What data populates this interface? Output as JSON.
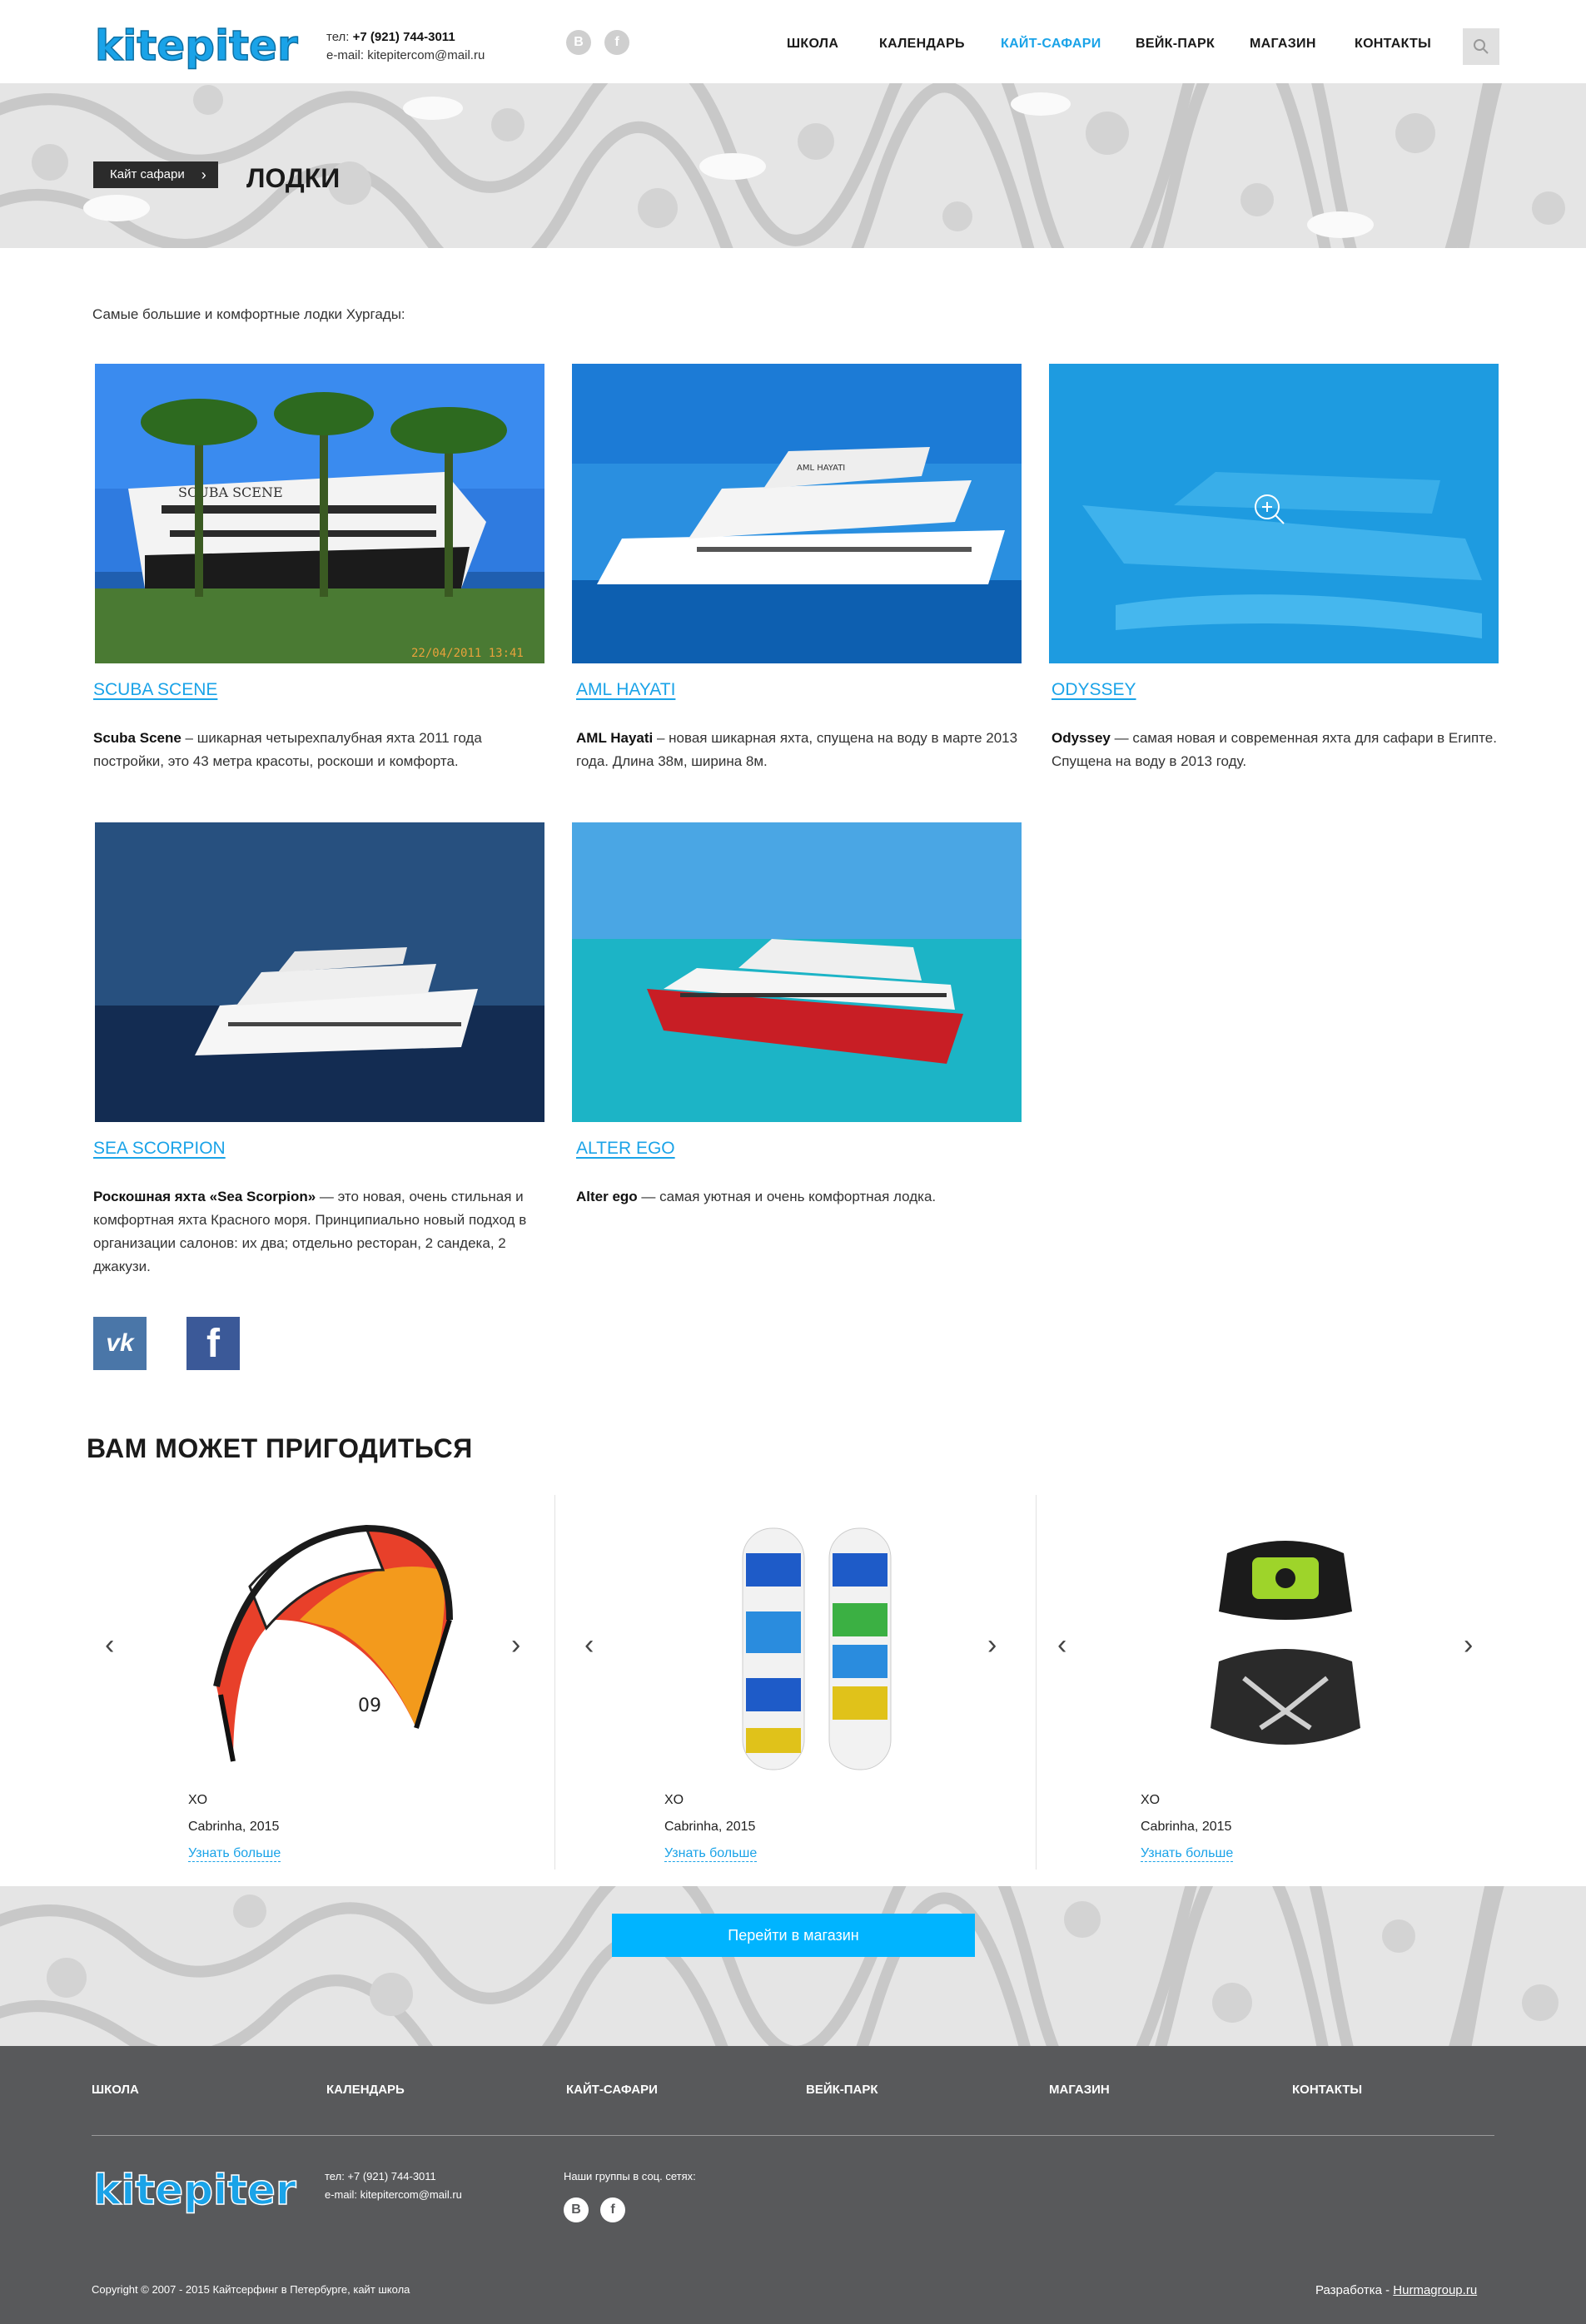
{
  "header": {
    "logo_text": "kitepiter",
    "phone_label": "тел:",
    "phone": "+7 (921) 744-3011",
    "email_label": "e-mail:",
    "email": "kitepitercom@mail.ru",
    "social": [
      "В",
      "f"
    ],
    "nav": [
      {
        "label": "ШКОЛА",
        "active": false
      },
      {
        "label": "КАЛЕНДАРЬ",
        "active": false
      },
      {
        "label": "КАЙТ-САФАРИ",
        "active": true
      },
      {
        "label": "ВЕЙК-ПАРК",
        "active": false
      },
      {
        "label": "МАГАЗИН",
        "active": false
      },
      {
        "label": "КОНТАКТЫ",
        "active": false
      }
    ]
  },
  "breadcrumb": "Кайт сафари",
  "page_title": "ЛОДКИ",
  "intro": "Самые большие и комфортные лодки Хургады:",
  "boats": [
    {
      "name": "SCUBA SCENE",
      "bold": "Scuba Scene",
      "text": " – шикарная четырехпалубная яхта 2011 года постройки, это 43 метра красоты, роскоши и комфорта.",
      "hull_text": "SCUBA SCENE",
      "photo_stamp": "22/04/2011 13:41"
    },
    {
      "name": "AML HAYATI",
      "bold": "AML Hayati",
      "text": " – новая шикарная яхта, спущена на воду в марте 2013 года. Длина 38м, ширина 8м.",
      "hull_text": "AML HAYATI"
    },
    {
      "name": "ODYSSEY",
      "bold": "Odyssey",
      "text": " — самая новая и современная яхта для сафари в Египте. Спущена на воду в 2013 году."
    },
    {
      "name": "SEA SCORPION",
      "bold": "Роскошная яхта «Sea Scorpion»",
      "text": " — это новая, очень стильная и комфортная яхта Красного моря. Принципиально новый подход в организации салонов: их два; отдельно ресторан, 2 сандека, 2 джакузи."
    },
    {
      "name": "ALTER EGO",
      "bold": "Alter ego",
      "text": " — самая уютная и очень комфортная лодка."
    }
  ],
  "share": {
    "vk": "vk",
    "fb": "f"
  },
  "related": {
    "title": "ВАМ МОЖЕТ ПРИГОДИТЬСЯ",
    "products": [
      {
        "title": "XO",
        "sub": "Cabrinha, 2015",
        "more": "Узнать больше",
        "icon": "kite",
        "print": "09"
      },
      {
        "title": "XO",
        "sub": "Cabrinha, 2015",
        "more": "Узнать больше",
        "icon": "kiteboard"
      },
      {
        "title": "XO",
        "sub": "Cabrinha, 2015",
        "more": "Узнать больше",
        "icon": "harness"
      }
    ],
    "prev": "‹",
    "next": "›"
  },
  "shop_button": "Перейти в магазин",
  "footer": {
    "nav": [
      "ШКОЛА",
      "КАЛЕНДАРЬ",
      "КАЙТ-САФАРИ",
      "ВЕЙК-ПАРК",
      "МАГАЗИН",
      "КОНТАКТЫ"
    ],
    "phone_line": "тел: +7 (921) 744-3011",
    "email_line": "e-mail: kitepitercom@mail.ru",
    "social_label": "Наши группы в соц. сетях:",
    "social": [
      "В",
      "f"
    ],
    "copyright": "Copyright © 2007 - 2015 Кайтсерфинг в Петербурге, кайт школа",
    "dev_label": "Разработка - ",
    "dev_link": "Hurmagroup.ru"
  },
  "colors": {
    "accent": "#1aa3e8",
    "button": "#00b4ff",
    "footer_bg": "#58595b",
    "crumb_bg": "#2b2b2b"
  }
}
